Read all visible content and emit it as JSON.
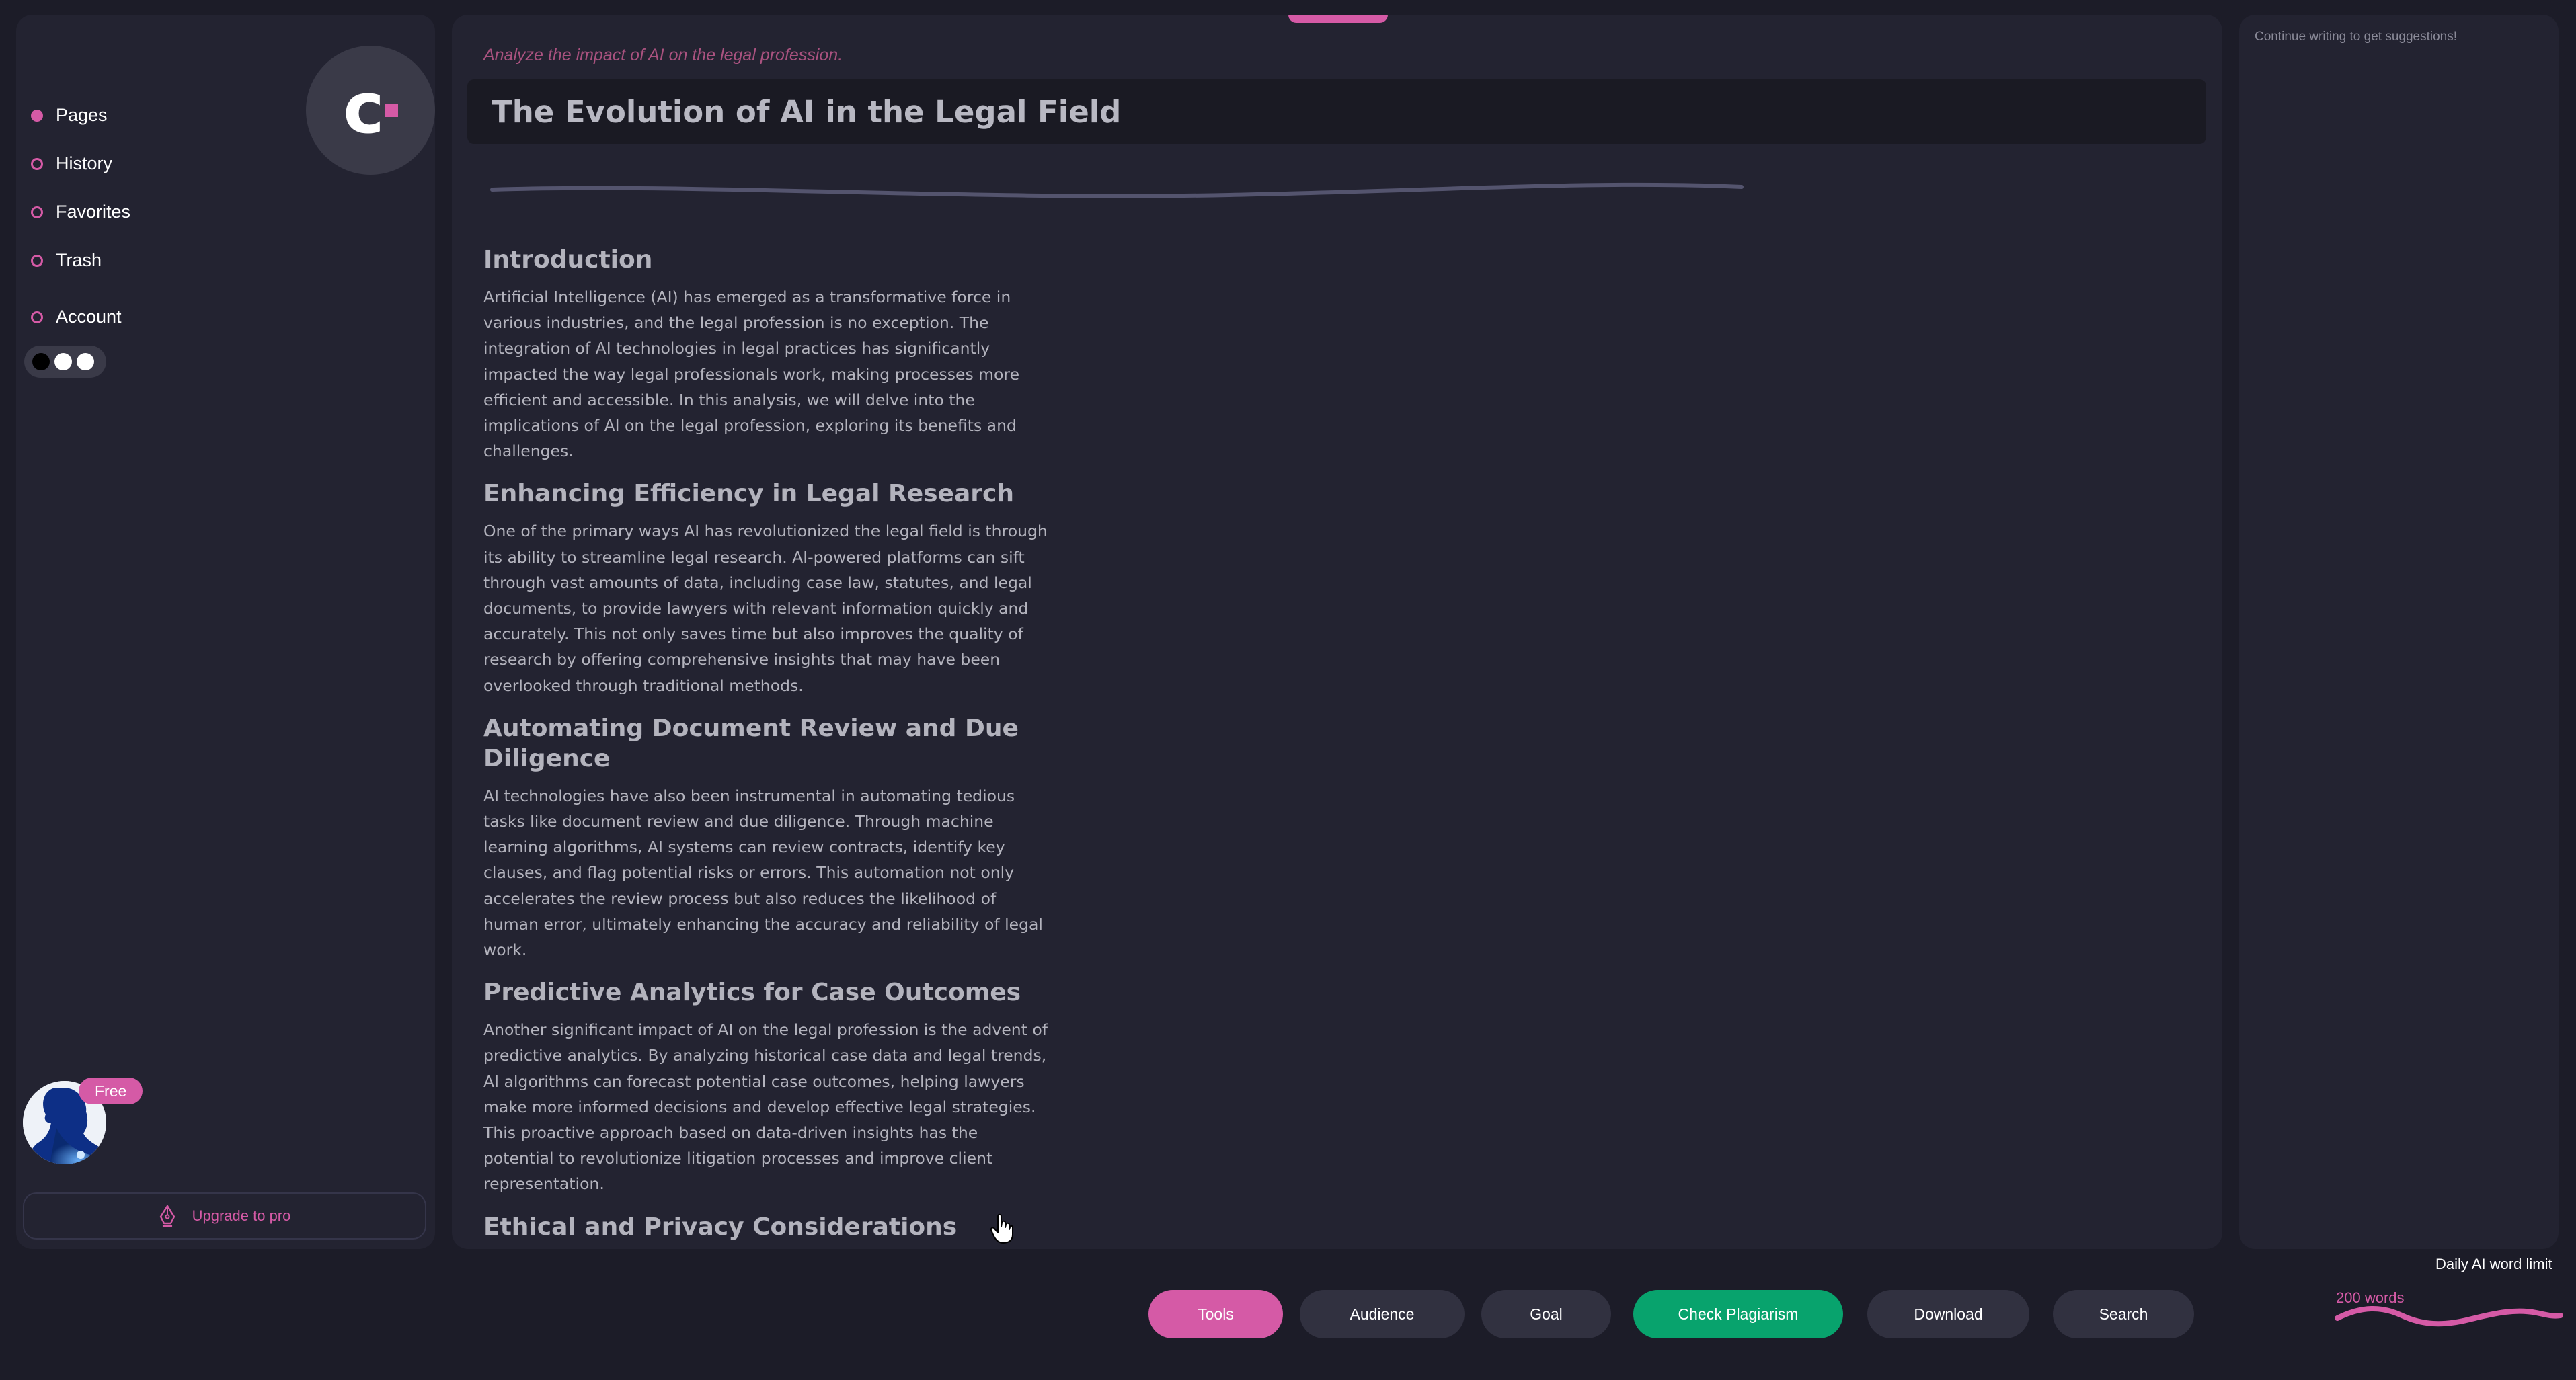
{
  "brand": {
    "logo_letter": "c",
    "accent_color": "#d55aa6"
  },
  "sidebar": {
    "items": [
      {
        "label": "Pages",
        "icon": "filled-circle-icon",
        "active": true
      },
      {
        "label": "History",
        "icon": "circle-icon",
        "active": false
      },
      {
        "label": "Favorites",
        "icon": "circle-icon",
        "active": false
      },
      {
        "label": "Trash",
        "icon": "circle-icon",
        "active": false
      },
      {
        "label": "Account",
        "icon": "circle-icon",
        "active": false
      }
    ],
    "theme_colors": [
      "#000000",
      "#ffffff",
      "#ffffff"
    ],
    "plan_badge": "Free",
    "upgrade_label": "Upgrade to pro",
    "upgrade_icon": "pen-nib-icon"
  },
  "editor": {
    "prompt": "Analyze the impact of AI on the legal profession.",
    "title": "The Evolution of AI in the Legal Field",
    "sections": [
      {
        "heading": "Introduction",
        "body": "Artificial Intelligence (AI) has emerged as a transformative force in various industries, and the legal profession is no exception. The integration of AI technologies in legal practices has significantly impacted the way legal professionals work, making processes more efficient and accessible. In this analysis, we will delve into the implications of AI on the legal profession, exploring its benefits and challenges."
      },
      {
        "heading": "Enhancing Efficiency in Legal Research",
        "body": "One of the primary ways AI has revolutionized the legal field is through its ability to streamline legal research. AI-powered platforms can sift through vast amounts of data, including case law, statutes, and legal documents, to provide lawyers with relevant information quickly and accurately. This not only saves time but also improves the quality of research by offering comprehensive insights that may have been overlooked through traditional methods."
      },
      {
        "heading": "Automating Document Review and Due Diligence",
        "body": "AI technologies have also been instrumental in automating tedious tasks like document review and due diligence. Through machine learning algorithms, AI systems can review contracts, identify key clauses, and flag potential risks or errors. This automation not only accelerates the review process but also reduces the likelihood of human error, ultimately enhancing the accuracy and reliability of legal work."
      },
      {
        "heading": "Predictive Analytics for Case Outcomes",
        "body": "Another significant impact of AI on the legal profession is the advent of predictive analytics. By analyzing historical case data and legal trends, AI algorithms can forecast potential case outcomes, helping lawyers make more informed decisions and develop effective legal strategies. This proactive approach based on data-driven insights has the potential to revolutionize litigation processes and improve client representation."
      },
      {
        "heading": "Ethical and Privacy Considerations",
        "body": ""
      }
    ]
  },
  "suggestions": {
    "placeholder": "Continue writing to get suggestions!"
  },
  "toolbar": {
    "buttons": [
      {
        "label": "Tools",
        "color": "#d55aa6",
        "text_color": "#ffffff"
      },
      {
        "label": "Audience",
        "color": "#313140",
        "text_color": "#ffffff"
      },
      {
        "label": "Goal",
        "color": "#313140",
        "text_color": "#ffffff"
      },
      {
        "label": "Check Plagiarism",
        "color": "#08a36d",
        "text_color": "#ffffff"
      },
      {
        "label": "Download",
        "color": "#313140",
        "text_color": "#ffffff"
      },
      {
        "label": "Search",
        "color": "#313140",
        "text_color": "#ffffff"
      }
    ]
  },
  "word_limit": {
    "label": "Daily AI word limit",
    "count": "200 words"
  }
}
